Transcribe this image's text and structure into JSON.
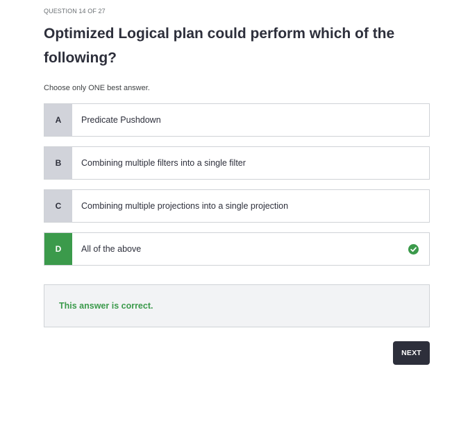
{
  "quiz": {
    "counter": "QUESTION 14 OF 27",
    "question": "Optimized Logical plan could perform which of the following?",
    "instruction": "Choose only ONE best answer."
  },
  "answers": [
    {
      "letter": "A",
      "text": "Predicate Pushdown",
      "correct": false
    },
    {
      "letter": "B",
      "text": "Combining multiple filters into a single filter",
      "correct": false
    },
    {
      "letter": "C",
      "text": "Combining multiple projections into a single projection",
      "correct": false
    },
    {
      "letter": "D",
      "text": "All of the above",
      "correct": true,
      "status_icon": "check-circle-icon"
    }
  ],
  "feedback": {
    "message": "This answer is correct."
  },
  "actions": {
    "next_label": "NEXT"
  },
  "colors": {
    "correct": "#3b9a4b",
    "letter_bg": "#d1d3da",
    "primary_button": "#2d2f3b"
  }
}
